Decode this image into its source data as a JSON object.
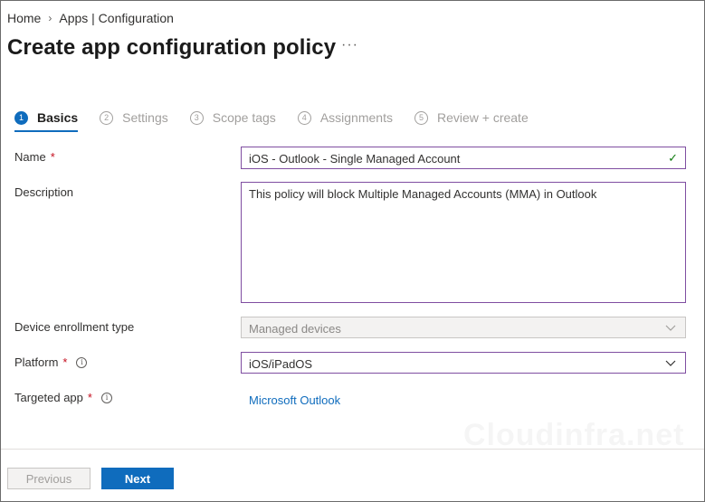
{
  "breadcrumb": {
    "home": "Home",
    "separator": "›",
    "current": "Apps | Configuration"
  },
  "page": {
    "title": "Create app configuration policy",
    "more": "···"
  },
  "steps": [
    {
      "num": "1",
      "label": "Basics",
      "active": true
    },
    {
      "num": "2",
      "label": "Settings",
      "active": false
    },
    {
      "num": "3",
      "label": "Scope tags",
      "active": false
    },
    {
      "num": "4",
      "label": "Assignments",
      "active": false
    },
    {
      "num": "5",
      "label": "Review + create",
      "active": false
    }
  ],
  "form": {
    "name": {
      "label": "Name",
      "required": "*",
      "value": "iOS - Outlook - Single Managed Account",
      "valid_icon": "✓"
    },
    "description": {
      "label": "Description",
      "value": "This policy will block Multiple Managed Accounts (MMA) in Outlook"
    },
    "enrollment": {
      "label": "Device enrollment type",
      "value": "Managed devices"
    },
    "platform": {
      "label": "Platform",
      "required": "*",
      "info": "i",
      "value": "iOS/iPadOS"
    },
    "targeted_app": {
      "label": "Targeted app",
      "required": "*",
      "info": "i",
      "value": "Microsoft Outlook"
    }
  },
  "watermark": "Cloudinfra.net",
  "footer": {
    "previous": "Previous",
    "next": "Next"
  },
  "icons": {
    "chevron": "chevron-down-icon",
    "check": "checkmark-icon",
    "info": "info-icon"
  },
  "colors": {
    "accent": "#0f6cbd",
    "field_border": "#7f4ea1",
    "required": "#c50f1f",
    "valid": "#107c10"
  }
}
